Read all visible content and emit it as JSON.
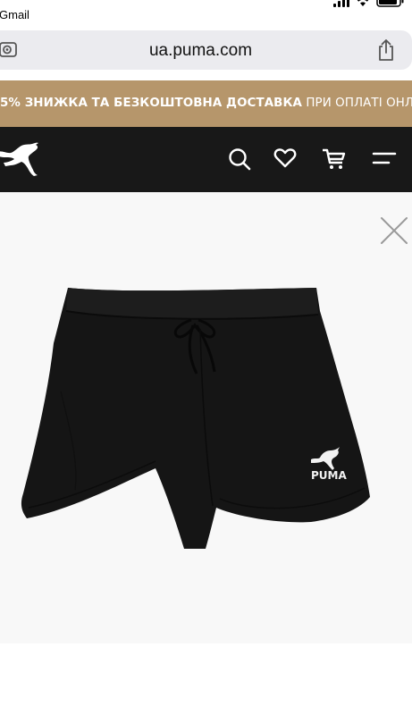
{
  "status_bar": {
    "back_app": "Gmail"
  },
  "browser": {
    "url": "ua.puma.com"
  },
  "promo": {
    "bold_text": "5% ЗНИЖКА ТА БЕЗКОШТОВНА ДОСТАВКА",
    "light_text": "ПРИ ОПЛАТІ ОНЛАЙН"
  },
  "header": {
    "icons": [
      "puma-logo-icon",
      "search-icon",
      "heart-icon",
      "cart-icon",
      "menu-icon"
    ]
  },
  "product": {
    "image_icon": "black-shorts-image",
    "logo_text": "PUMA"
  },
  "colors": {
    "promo_bg": "#b6966b",
    "nav_bg": "#181818",
    "product_bg": "#f8f8f8"
  }
}
